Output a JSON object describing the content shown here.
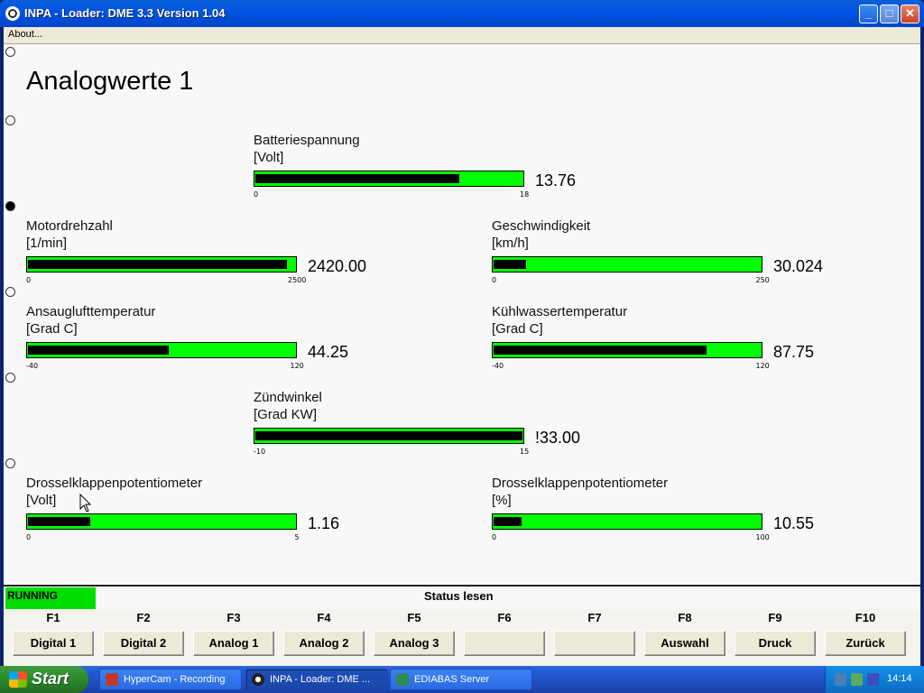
{
  "window": {
    "title": "INPA - Loader:  DME 3.3 Version 1.04",
    "minimize_label": "_",
    "maximize_label": "□",
    "close_label": "✕"
  },
  "menu": {
    "about": "About..."
  },
  "page": {
    "title": "Analogwerte 1"
  },
  "gauges": [
    {
      "id": "batteriespannung",
      "name": "Batteriespannung",
      "unit": "[Volt]",
      "value": "13.76",
      "min": "0",
      "max": "18",
      "fill_fraction": 0.764
    },
    {
      "id": "motordrehzahl",
      "name": "Motordrehzahl",
      "unit": "[1/min]",
      "value": "2420.00",
      "min": "0",
      "max": "2500",
      "fill_fraction": 0.968
    },
    {
      "id": "geschwindigkeit",
      "name": "Geschwindigkeit",
      "unit": "[km/h]",
      "value": "30.024",
      "min": "0",
      "max": "250",
      "fill_fraction": 0.12
    },
    {
      "id": "ansauglufttemperatur",
      "name": "Ansauglufttemperatur",
      "unit": "[Grad C]",
      "value": "44.25",
      "min": "-40",
      "max": "120",
      "fill_fraction": 0.527
    },
    {
      "id": "kuehlwassertemperatur",
      "name": "Kühlwassertemperatur",
      "unit": "[Grad C]",
      "value": "87.75",
      "min": "-40",
      "max": "120",
      "fill_fraction": 0.798
    },
    {
      "id": "zuendwinkel",
      "name": "Zündwinkel",
      "unit": "[Grad KW]",
      "value": "!33.00",
      "min": "-10",
      "max": "15",
      "fill_fraction": 1.0
    },
    {
      "id": "drosselklappe-volt",
      "name": "Drosselklappenpotentiometer",
      "unit": "[Volt]",
      "value": "1.16",
      "min": "0",
      "max": "5",
      "fill_fraction": 0.232
    },
    {
      "id": "drosselklappe-prozent",
      "name": "Drosselklappenpotentiometer",
      "unit": "[%]",
      "value": "10.55",
      "min": "0",
      "max": "100",
      "fill_fraction": 0.1055
    }
  ],
  "status": {
    "running": "RUNNING",
    "label": "Status lesen",
    "running_color": "#00dd00"
  },
  "fkeys": [
    {
      "key": "F1",
      "label": "Digital 1"
    },
    {
      "key": "F2",
      "label": "Digital 2"
    },
    {
      "key": "F3",
      "label": "Analog 1"
    },
    {
      "key": "F4",
      "label": "Analog 2"
    },
    {
      "key": "F5",
      "label": "Analog 3"
    },
    {
      "key": "F6",
      "label": ""
    },
    {
      "key": "F7",
      "label": ""
    },
    {
      "key": "F8",
      "label": "Auswahl"
    },
    {
      "key": "F9",
      "label": "Druck"
    },
    {
      "key": "F10",
      "label": "Zurück"
    }
  ],
  "taskbar": {
    "start": "Start",
    "items": [
      {
        "label": "HyperCam - Recording",
        "icon": "hypercam-icon",
        "active": false
      },
      {
        "label": "INPA - Loader:  DME ...",
        "icon": "bmw-icon",
        "active": true
      },
      {
        "label": "EDIABAS Server",
        "icon": "ediabas-icon",
        "active": false
      }
    ],
    "clock": "14:14"
  },
  "colors": {
    "bar_background": "#00ff00",
    "bar_fill": "#000000",
    "titlebar": "#0054e3"
  }
}
